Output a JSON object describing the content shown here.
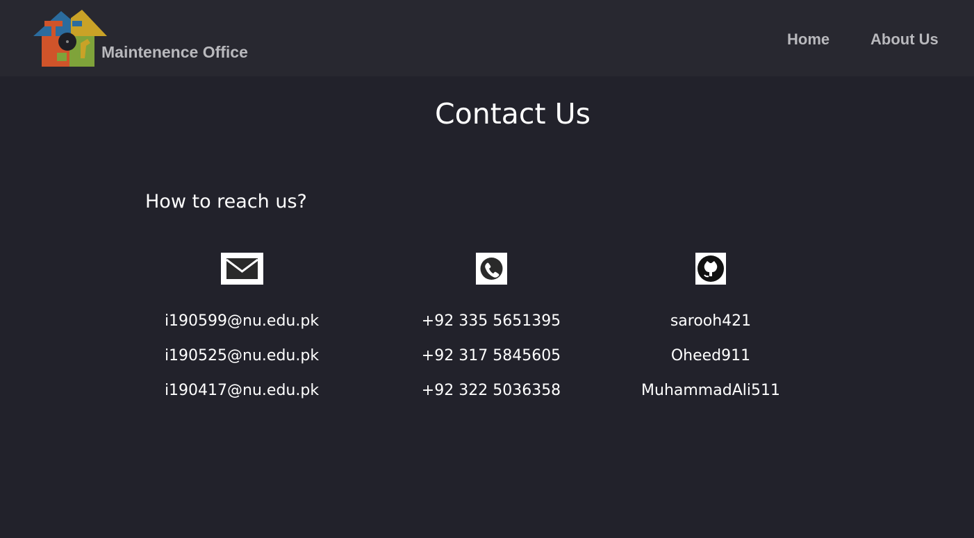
{
  "header": {
    "brand": "Maintenence Office",
    "nav": [
      {
        "label": "Home"
      },
      {
        "label": "About Us"
      }
    ]
  },
  "main": {
    "title": "Contact Us",
    "subtitle": "How to reach us?",
    "columns": [
      {
        "icon": "mail-icon",
        "items": [
          "i190599@nu.edu.pk",
          "i190525@nu.edu.pk",
          "i190417@nu.edu.pk"
        ]
      },
      {
        "icon": "phone-icon",
        "items": [
          "+92 335 5651395",
          "+92 317 5845605",
          "+92 322 5036358"
        ]
      },
      {
        "icon": "github-icon",
        "items": [
          "sarooh421",
          "Oheed911",
          "MuhammadAli511"
        ]
      }
    ]
  },
  "colors": {
    "background": "#22222b",
    "header_background": "#282830",
    "nav_text": "#b9b9bd",
    "text": "#ffffff"
  }
}
